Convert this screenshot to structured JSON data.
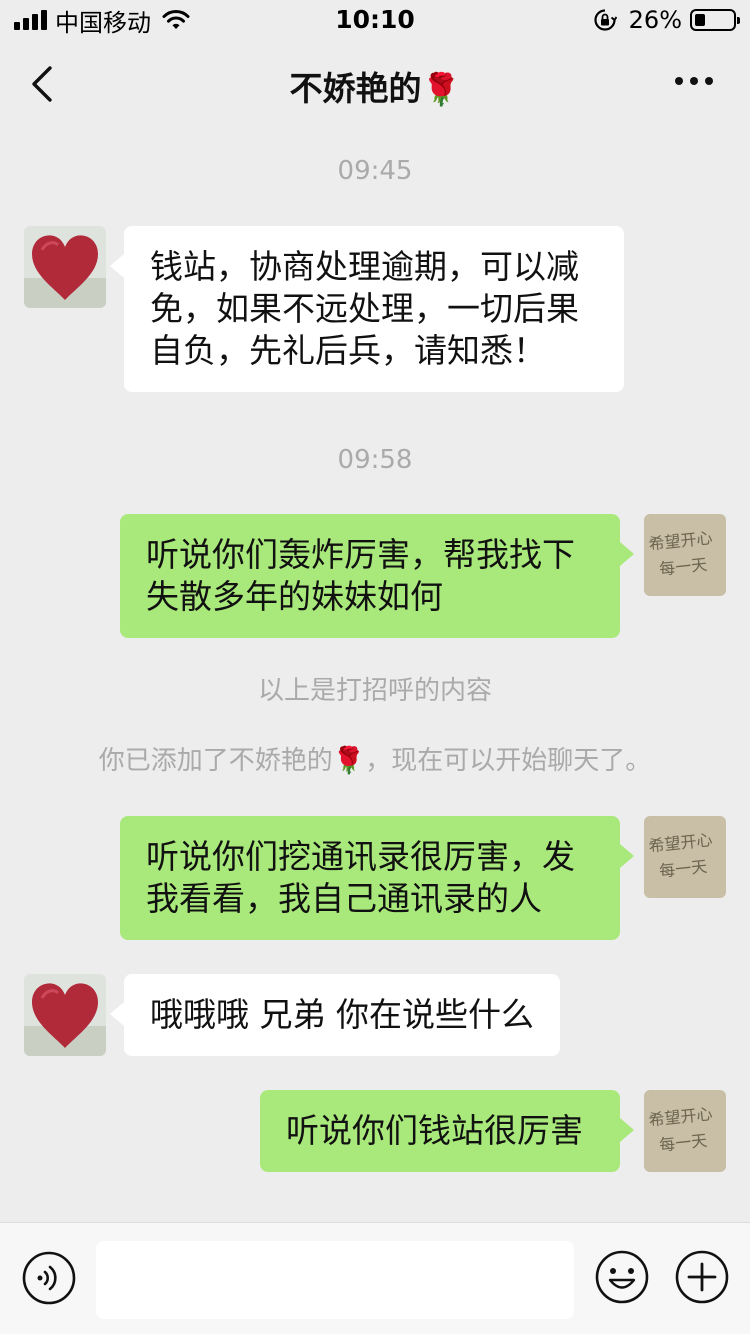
{
  "status_bar": {
    "carrier": "中国移动",
    "time": "10:10",
    "battery": "26%"
  },
  "nav": {
    "title": "不娇艳的",
    "title_emoji": "🌹"
  },
  "chat": {
    "timestamps": [
      "09:45",
      "09:58"
    ],
    "messages": [
      {
        "side": "in",
        "text": "钱站，协商处理逾期，可以减免，如果不远处理，一切后果自负，先礼后兵，请知悉！"
      },
      {
        "side": "out",
        "text": "听说你们轰炸厉害，帮我找下失散多年的妹妹如何"
      },
      {
        "side": "out",
        "text": "听说你们挖通讯录很厉害，发我看看，我自己通讯录的人"
      },
      {
        "side": "in",
        "text": "哦哦哦 兄弟 你在说些什么"
      },
      {
        "side": "out",
        "text": "听说你们钱站很厉害"
      }
    ],
    "system_notes": {
      "greeting_above": "以上是打招呼的内容",
      "added_prefix": "你已添加了不娇艳的",
      "added_emoji": "🌹",
      "added_suffix": "，现在可以开始聊天了。"
    }
  },
  "my_avatar_text": [
    "希望开心",
    "每一天"
  ],
  "colors": {
    "background": "#ededed",
    "incoming_bubble": "#ffffff",
    "outgoing_bubble": "#a9e97b"
  },
  "input": {
    "value": ""
  }
}
